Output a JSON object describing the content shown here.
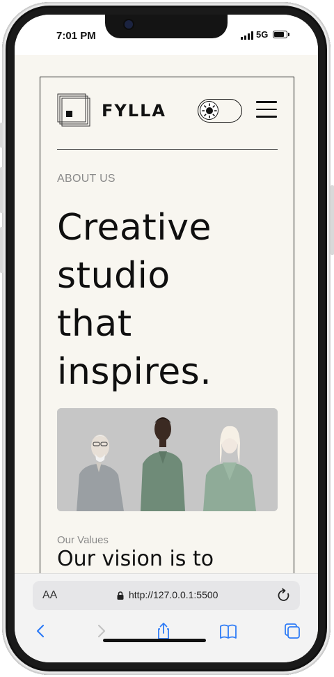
{
  "status_bar": {
    "time": "7:01 PM",
    "network": "5G"
  },
  "site": {
    "brand": "FYLLA",
    "theme_toggle_icon": "sun-icon",
    "menu_icon": "hamburger-menu-icon",
    "eyebrow": "ABOUT US",
    "hero_lines": [
      "Creative",
      "studio",
      "that",
      "inspires."
    ],
    "values_label": "Our Values",
    "values_title": "Our vision is to"
  },
  "browser": {
    "text_size_label": "AA",
    "url": "http://127.0.0.1:5500",
    "toolbar": [
      "back-icon",
      "forward-icon",
      "share-icon",
      "bookmarks-icon",
      "tabs-icon"
    ]
  },
  "colors": {
    "page_bg": "#f8f6f0",
    "ink": "#111111",
    "muted": "#8a8a8a",
    "safari_blue": "#2f7cf6"
  }
}
